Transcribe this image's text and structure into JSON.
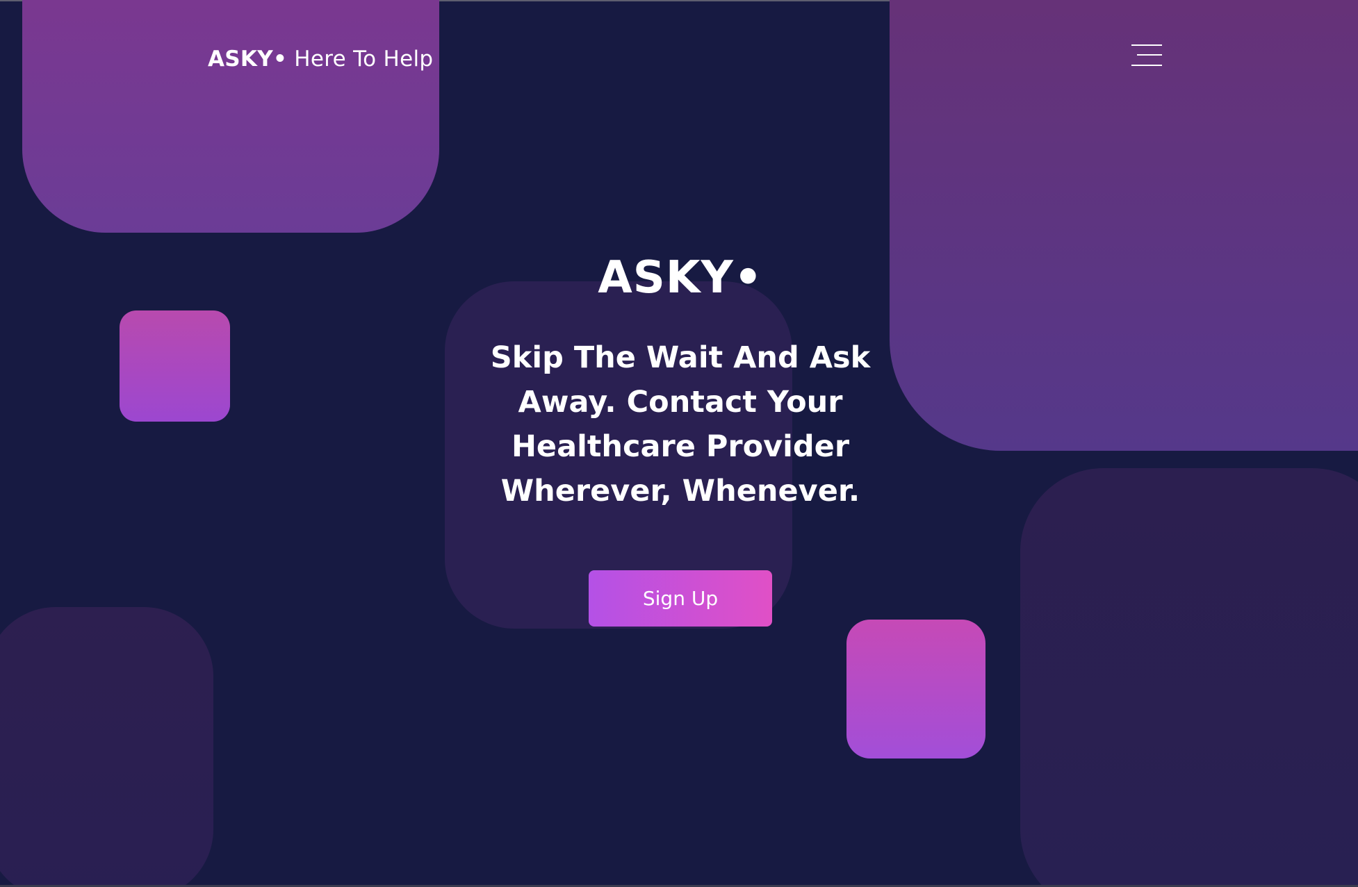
{
  "header": {
    "brand_name": "ASKY•",
    "brand_tagline": "Here To Help",
    "menu_icon": "hamburger-menu-icon"
  },
  "hero": {
    "logo": "ASKY•",
    "headline": "Skip The Wait And Ask Away. Contact Your Healthcare Provider Wherever, Whenever.",
    "cta_label": "Sign Up"
  },
  "colors": {
    "background": "#171a42",
    "accent_gradient_start": "#b451e6",
    "accent_gradient_end": "#e050c6",
    "text": "#ffffff"
  }
}
